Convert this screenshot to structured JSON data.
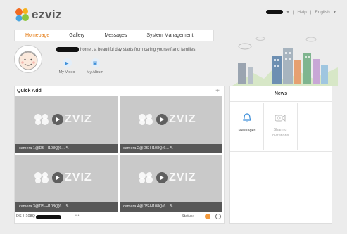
{
  "header": {
    "logo_text": "ezviz",
    "help": "Help",
    "language": "English",
    "separator": "|"
  },
  "nav": [
    "Homepage",
    "Gallery",
    "Messages",
    "System Management"
  ],
  "profile": {
    "greeting": "home , a beautiful day starts from caring yourself and families.",
    "shortcuts": [
      "My Video",
      "My Album"
    ]
  },
  "quick_add": {
    "title": "Quick Add",
    "plus": "+",
    "tile_brand": "ZVIZ",
    "cameras": [
      "camera 1@DS-H108Q(6... ✎",
      "camera 2@DS-H108Q(6... ✎",
      "camera 3@DS-H108Q(6... ✎",
      "camera 4@DS-H108Q(6... ✎"
    ],
    "device_prefix": "DS-H108Q",
    "status_label": "Status:"
  },
  "news": {
    "title": "News",
    "items": [
      {
        "label": "Messages",
        "icon": "bell-icon"
      },
      {
        "label": "Sharing Invitations",
        "icon": "camera-share-icon"
      }
    ]
  },
  "colors": {
    "accent": "#e4780e",
    "tile_bg": "#c9c9c9",
    "tile_bar": "#575757"
  }
}
